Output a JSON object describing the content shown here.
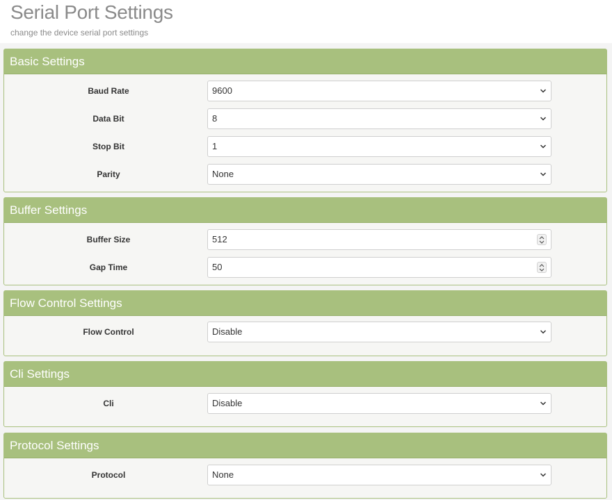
{
  "header": {
    "title": "Serial Port Settings",
    "subtitle": "change the device serial port settings"
  },
  "sections": {
    "basic": {
      "title": "Basic Settings",
      "baud_rate": {
        "label": "Baud Rate",
        "value": "9600"
      },
      "data_bit": {
        "label": "Data Bit",
        "value": "8"
      },
      "stop_bit": {
        "label": "Stop Bit",
        "value": "1"
      },
      "parity": {
        "label": "Parity",
        "value": "None"
      }
    },
    "buffer": {
      "title": "Buffer Settings",
      "buffer_size": {
        "label": "Buffer Size",
        "value": "512"
      },
      "gap_time": {
        "label": "Gap Time",
        "value": "50"
      }
    },
    "flow": {
      "title": "Flow Control Settings",
      "flow_control": {
        "label": "Flow Control",
        "value": "Disable"
      }
    },
    "cli": {
      "title": "Cli Settings",
      "cli": {
        "label": "Cli",
        "value": "Disable"
      }
    },
    "protocol": {
      "title": "Protocol Settings",
      "protocol": {
        "label": "Protocol",
        "value": "None"
      }
    }
  },
  "icons": {
    "select": "chevron-down-icon",
    "number": "spinner-icon"
  },
  "colors": {
    "panel_header": "#a8c07e",
    "panel_border": "#a9c07f",
    "title_text": "#8a8a8a"
  }
}
